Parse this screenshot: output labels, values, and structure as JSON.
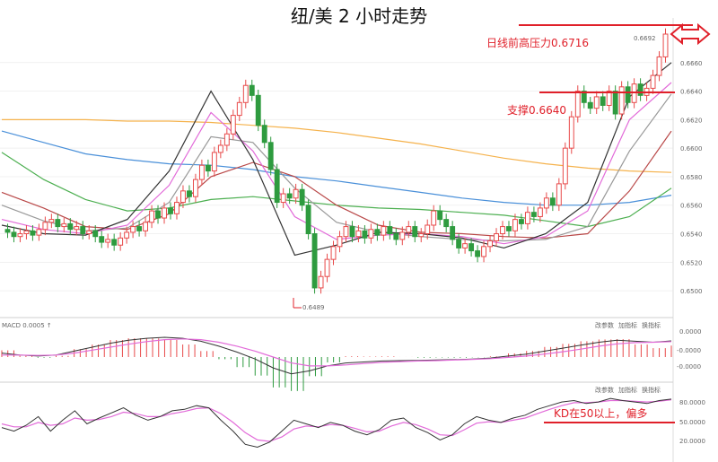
{
  "chart_data": {
    "type": "candlestick",
    "title": "纽/美 2 小时走势",
    "price_axis": {
      "ticks": [
        "0.6660",
        "0.6640",
        "0.6620",
        "0.6600",
        "0.6580",
        "0.6560",
        "0.6540",
        "0.6520",
        "0.6500"
      ],
      "range": [
        0.649,
        0.668
      ]
    },
    "low_label": "0.6489",
    "high_label": "0.6692",
    "annotations": {
      "resistance": "日线前高压力0.6716",
      "support": "支撑0.6640",
      "kd_note": "KD在50以上，偏多"
    },
    "macd_panel": {
      "label": "MACD 0.0005 ↑",
      "ticks": [
        "0.0000",
        "-0.0000",
        "-0.0000"
      ],
      "buttons": [
        "改参数",
        "加指标",
        "换指标"
      ]
    },
    "kd_panel": {
      "ticks": [
        "80.0000",
        "50.0000",
        "20.0000"
      ],
      "buttons": [
        "改参数",
        "加指标",
        "换指标"
      ]
    },
    "candles": [
      [
        0.6543,
        0.6541
      ],
      [
        0.6541,
        0.6538
      ],
      [
        0.6538,
        0.654
      ],
      [
        0.654,
        0.6542
      ],
      [
        0.6542,
        0.6539
      ],
      [
        0.6539,
        0.6543
      ],
      [
        0.6543,
        0.6548
      ],
      [
        0.6548,
        0.655
      ],
      [
        0.655,
        0.6545
      ],
      [
        0.6545,
        0.6547
      ],
      [
        0.6547,
        0.6543
      ],
      [
        0.6543,
        0.6545
      ],
      [
        0.6545,
        0.654
      ],
      [
        0.654,
        0.6542
      ],
      [
        0.6542,
        0.6538
      ],
      [
        0.6538,
        0.6534
      ],
      [
        0.6534,
        0.6536
      ],
      [
        0.6536,
        0.6532
      ],
      [
        0.6532,
        0.6537
      ],
      [
        0.6537,
        0.6541
      ],
      [
        0.6541,
        0.6545
      ],
      [
        0.6545,
        0.6542
      ],
      [
        0.6542,
        0.6548
      ],
      [
        0.6548,
        0.6556
      ],
      [
        0.6556,
        0.6551
      ],
      [
        0.6551,
        0.6558
      ],
      [
        0.6558,
        0.6554
      ],
      [
        0.6554,
        0.6562
      ],
      [
        0.6562,
        0.657
      ],
      [
        0.657,
        0.6566
      ],
      [
        0.6566,
        0.6578
      ],
      [
        0.6578,
        0.6588
      ],
      [
        0.6588,
        0.6584
      ],
      [
        0.6584,
        0.6597
      ],
      [
        0.6597,
        0.6602
      ],
      [
        0.6602,
        0.661
      ],
      [
        0.661,
        0.6623
      ],
      [
        0.6623,
        0.6632
      ],
      [
        0.6632,
        0.6644
      ],
      [
        0.6644,
        0.6637
      ],
      [
        0.6637,
        0.6616
      ],
      [
        0.6616,
        0.6604
      ],
      [
        0.6604,
        0.6585
      ],
      [
        0.6585,
        0.6562
      ],
      [
        0.6562,
        0.6568
      ],
      [
        0.6568,
        0.6565
      ],
      [
        0.6565,
        0.6571
      ],
      [
        0.6571,
        0.656
      ],
      [
        0.656,
        0.654
      ],
      [
        0.654,
        0.6502
      ],
      [
        0.6502,
        0.651
      ],
      [
        0.651,
        0.6522
      ],
      [
        0.6522,
        0.6531
      ],
      [
        0.6531,
        0.6538
      ],
      [
        0.6538,
        0.6545
      ],
      [
        0.6545,
        0.6538
      ],
      [
        0.6538,
        0.6542
      ],
      [
        0.6542,
        0.6537
      ],
      [
        0.6537,
        0.6543
      ],
      [
        0.6543,
        0.6539
      ],
      [
        0.6539,
        0.6545
      ],
      [
        0.6545,
        0.654
      ],
      [
        0.654,
        0.6536
      ],
      [
        0.6536,
        0.6541
      ],
      [
        0.6541,
        0.6545
      ],
      [
        0.6545,
        0.6538
      ],
      [
        0.6538,
        0.654
      ],
      [
        0.654,
        0.6546
      ],
      [
        0.6546,
        0.6556
      ],
      [
        0.6556,
        0.655
      ],
      [
        0.655,
        0.6545
      ],
      [
        0.6545,
        0.6536
      ],
      [
        0.6536,
        0.653
      ],
      [
        0.653,
        0.6533
      ],
      [
        0.6533,
        0.6528
      ],
      [
        0.6528,
        0.6524
      ],
      [
        0.6524,
        0.6531
      ],
      [
        0.6531,
        0.6535
      ],
      [
        0.6535,
        0.654
      ],
      [
        0.654,
        0.6545
      ],
      [
        0.6545,
        0.6542
      ],
      [
        0.6542,
        0.655
      ],
      [
        0.655,
        0.6547
      ],
      [
        0.6547,
        0.6555
      ],
      [
        0.6555,
        0.6552
      ],
      [
        0.6552,
        0.6558
      ],
      [
        0.6558,
        0.6565
      ],
      [
        0.6565,
        0.656
      ],
      [
        0.656,
        0.6575
      ],
      [
        0.6575,
        0.66
      ],
      [
        0.66,
        0.6622
      ],
      [
        0.6622,
        0.664
      ],
      [
        0.664,
        0.6632
      ],
      [
        0.6632,
        0.6628
      ],
      [
        0.6628,
        0.6636
      ],
      [
        0.6636,
        0.663
      ],
      [
        0.663,
        0.664
      ],
      [
        0.664,
        0.6624
      ],
      [
        0.6624,
        0.6643
      ],
      [
        0.6643,
        0.6632
      ],
      [
        0.6632,
        0.6645
      ],
      [
        0.6645,
        0.6637
      ],
      [
        0.6637,
        0.6642
      ],
      [
        0.6642,
        0.6651
      ],
      [
        0.6651,
        0.6664
      ],
      [
        0.6664,
        0.668
      ]
    ],
    "ma_series": [
      {
        "color": "#f5b24c",
        "values": [
          0.662,
          0.662,
          0.662,
          0.6619,
          0.6619,
          0.6618,
          0.6616,
          0.6614,
          0.6611,
          0.6607,
          0.6603,
          0.6598,
          0.6593,
          0.6589,
          0.6586,
          0.6584,
          0.6583
        ]
      },
      {
        "color": "#4a90d9",
        "values": [
          0.6612,
          0.6604,
          0.6596,
          0.6592,
          0.6589,
          0.6588,
          0.6585,
          0.658,
          0.6577,
          0.6573,
          0.6569,
          0.6565,
          0.6562,
          0.656,
          0.656,
          0.6562,
          0.6567
        ]
      },
      {
        "color": "#4caf50",
        "values": [
          0.6597,
          0.6578,
          0.6564,
          0.6556,
          0.6558,
          0.6564,
          0.6566,
          0.6563,
          0.656,
          0.6558,
          0.6557,
          0.6555,
          0.6553,
          0.6549,
          0.6545,
          0.6552,
          0.6572
        ]
      },
      {
        "color": "#b94848",
        "values": [
          0.6569,
          0.6558,
          0.6545,
          0.6543,
          0.6554,
          0.658,
          0.659,
          0.658,
          0.656,
          0.6546,
          0.6541,
          0.654,
          0.6538,
          0.6537,
          0.654,
          0.657,
          0.6612
        ]
      },
      {
        "color": "#999999",
        "values": [
          0.656,
          0.6549,
          0.6542,
          0.6544,
          0.6562,
          0.6608,
          0.6604,
          0.6572,
          0.6548,
          0.6541,
          0.6538,
          0.6536,
          0.6535,
          0.6536,
          0.6545,
          0.6598,
          0.6638
        ]
      },
      {
        "color": "#e26bd9",
        "values": [
          0.655,
          0.6543,
          0.654,
          0.6546,
          0.6574,
          0.6625,
          0.6598,
          0.6552,
          0.6536,
          0.6539,
          0.654,
          0.6538,
          0.6533,
          0.6538,
          0.6556,
          0.662,
          0.6646
        ]
      },
      {
        "color": "#333333",
        "values": [
          0.6546,
          0.654,
          0.6539,
          0.655,
          0.6584,
          0.664,
          0.6592,
          0.6525,
          0.6532,
          0.6541,
          0.654,
          0.6537,
          0.653,
          0.654,
          0.6562,
          0.6636,
          0.666
        ]
      }
    ],
    "macd_dif": [
      0.2,
      0.1,
      0.05,
      0.1,
      0.3,
      0.5,
      0.7,
      0.85,
      0.95,
      1.0,
      0.95,
      0.8,
      0.55,
      0.25,
      -0.1,
      -0.55,
      -0.85,
      -0.7,
      -0.45,
      -0.3,
      -0.25,
      -0.2,
      -0.18,
      -0.17,
      -0.15,
      -0.13,
      -0.1,
      -0.05,
      0.05,
      0.15,
      0.3,
      0.45,
      0.6,
      0.75,
      0.85,
      0.8,
      0.75,
      0.82
    ],
    "macd_dea": [
      0.1,
      0.1,
      0.08,
      0.1,
      0.2,
      0.35,
      0.5,
      0.65,
      0.78,
      0.88,
      0.92,
      0.88,
      0.75,
      0.55,
      0.3,
      0.0,
      -0.3,
      -0.45,
      -0.45,
      -0.4,
      -0.33,
      -0.27,
      -0.23,
      -0.2,
      -0.18,
      -0.15,
      -0.12,
      -0.08,
      -0.02,
      0.05,
      0.15,
      0.27,
      0.4,
      0.55,
      0.67,
      0.73,
      0.75,
      0.78
    ],
    "kd_k": [
      45,
      40,
      48,
      60,
      40,
      55,
      68,
      50,
      58,
      65,
      72,
      62,
      55,
      60,
      68,
      70,
      75,
      72,
      55,
      40,
      22,
      18,
      25,
      40,
      55,
      50,
      45,
      52,
      48,
      40,
      35,
      42,
      55,
      58,
      45,
      38,
      28,
      35,
      50,
      60,
      55,
      52,
      58,
      62,
      70,
      75,
      80,
      82,
      78,
      80,
      85,
      82,
      80,
      78,
      82,
      84
    ],
    "kd_d": [
      50,
      46,
      46,
      52,
      48,
      50,
      58,
      55,
      56,
      60,
      66,
      64,
      60,
      60,
      64,
      67,
      71,
      72,
      64,
      52,
      38,
      28,
      26,
      32,
      43,
      47,
      46,
      49,
      48,
      44,
      39,
      40,
      47,
      52,
      49,
      43,
      35,
      34,
      42,
      51,
      53,
      52,
      55,
      58,
      64,
      70,
      75,
      79,
      79,
      80,
      82,
      82,
      81,
      80,
      81,
      83
    ]
  }
}
